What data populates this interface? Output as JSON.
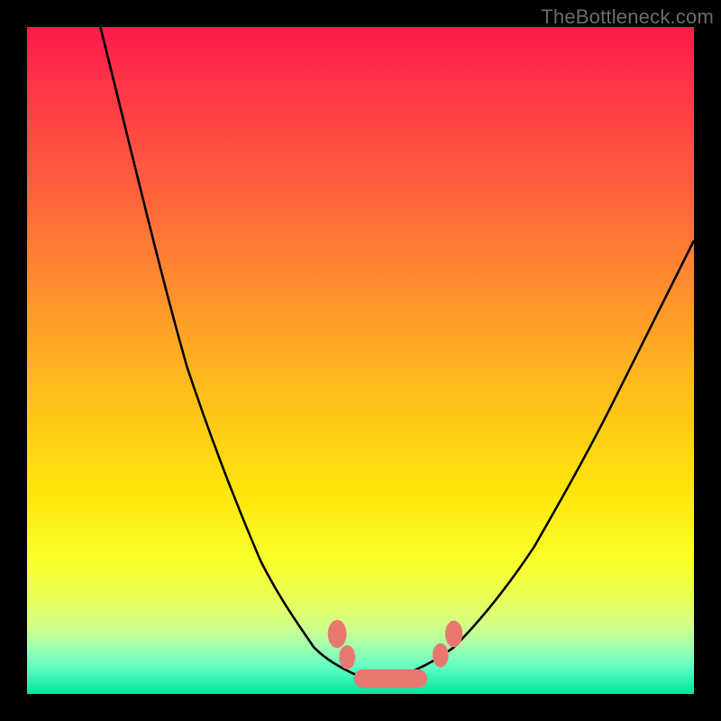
{
  "watermark": {
    "text": "TheBottleneck.com"
  },
  "colors": {
    "frame": "#000000",
    "gradient_top": "#ff1a4b",
    "gradient_bottom": "#00e59a",
    "curve": "#000000",
    "marker": "#e8786f"
  },
  "chart_data": {
    "type": "line",
    "title": "",
    "xlabel": "",
    "ylabel": "",
    "xlim": [
      0,
      100
    ],
    "ylim": [
      0,
      100
    ],
    "grid": false,
    "legend": false,
    "series": [
      {
        "name": "left-curve",
        "x": [
          11,
          16,
          20,
          24,
          28,
          32,
          35,
          38,
          41,
          43,
          45,
          47,
          49,
          51,
          53
        ],
        "y": [
          100,
          80,
          63,
          49,
          37,
          27,
          20,
          14,
          10,
          7,
          5,
          4,
          3,
          2.5,
          2
        ]
      },
      {
        "name": "right-curve",
        "x": [
          53,
          56,
          60,
          64,
          68,
          72,
          76,
          80,
          84,
          88,
          92,
          96,
          100
        ],
        "y": [
          2,
          2.5,
          4,
          7,
          11,
          16,
          22,
          29,
          36,
          44,
          52,
          60,
          68
        ]
      }
    ],
    "markers": [
      {
        "shape": "dot",
        "x": 47,
        "y": 9
      },
      {
        "shape": "dot",
        "x": 48,
        "y": 6
      },
      {
        "shape": "capsule",
        "x": 54,
        "y": 2,
        "w": 10
      },
      {
        "shape": "dot",
        "x": 62,
        "y": 6
      },
      {
        "shape": "dot",
        "x": 64,
        "y": 9
      }
    ]
  }
}
